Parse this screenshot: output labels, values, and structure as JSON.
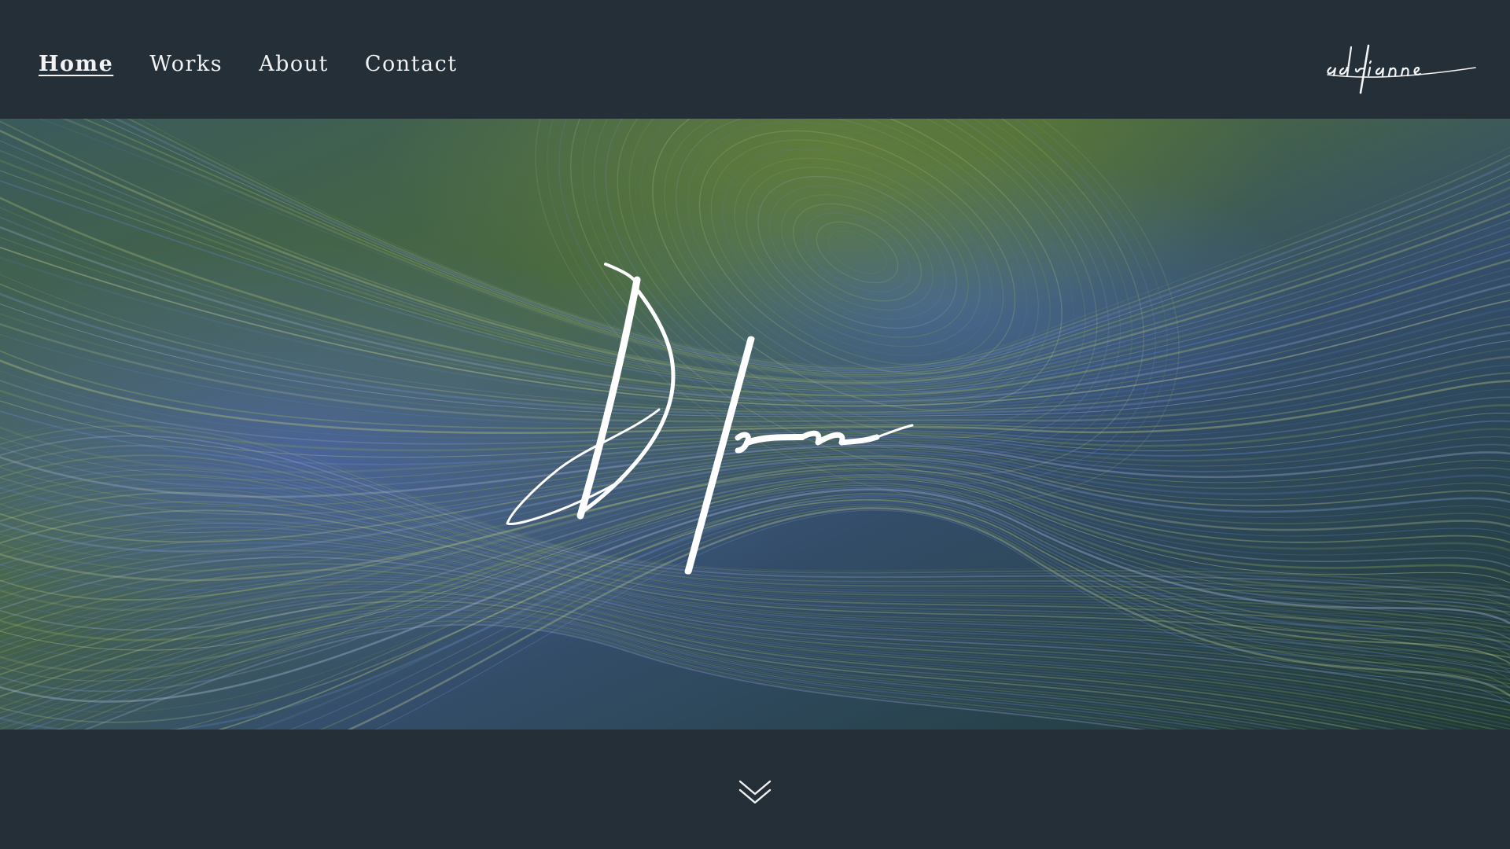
{
  "nav": {
    "items": [
      {
        "label": "Home",
        "active": true
      },
      {
        "label": "Works",
        "active": false
      },
      {
        "label": "About",
        "active": false
      },
      {
        "label": "Contact",
        "active": false
      }
    ]
  },
  "brand": {
    "logo_icon": "adrianne-signature-logo",
    "hero_icon": "blen-signature-logo"
  },
  "icons": {
    "scroll": "double-chevron-down-icon"
  },
  "colors": {
    "background": "#252f37",
    "text": "#f2f2f2",
    "hero_green": "#556b3a",
    "hero_blue": "#3c5a9a"
  }
}
